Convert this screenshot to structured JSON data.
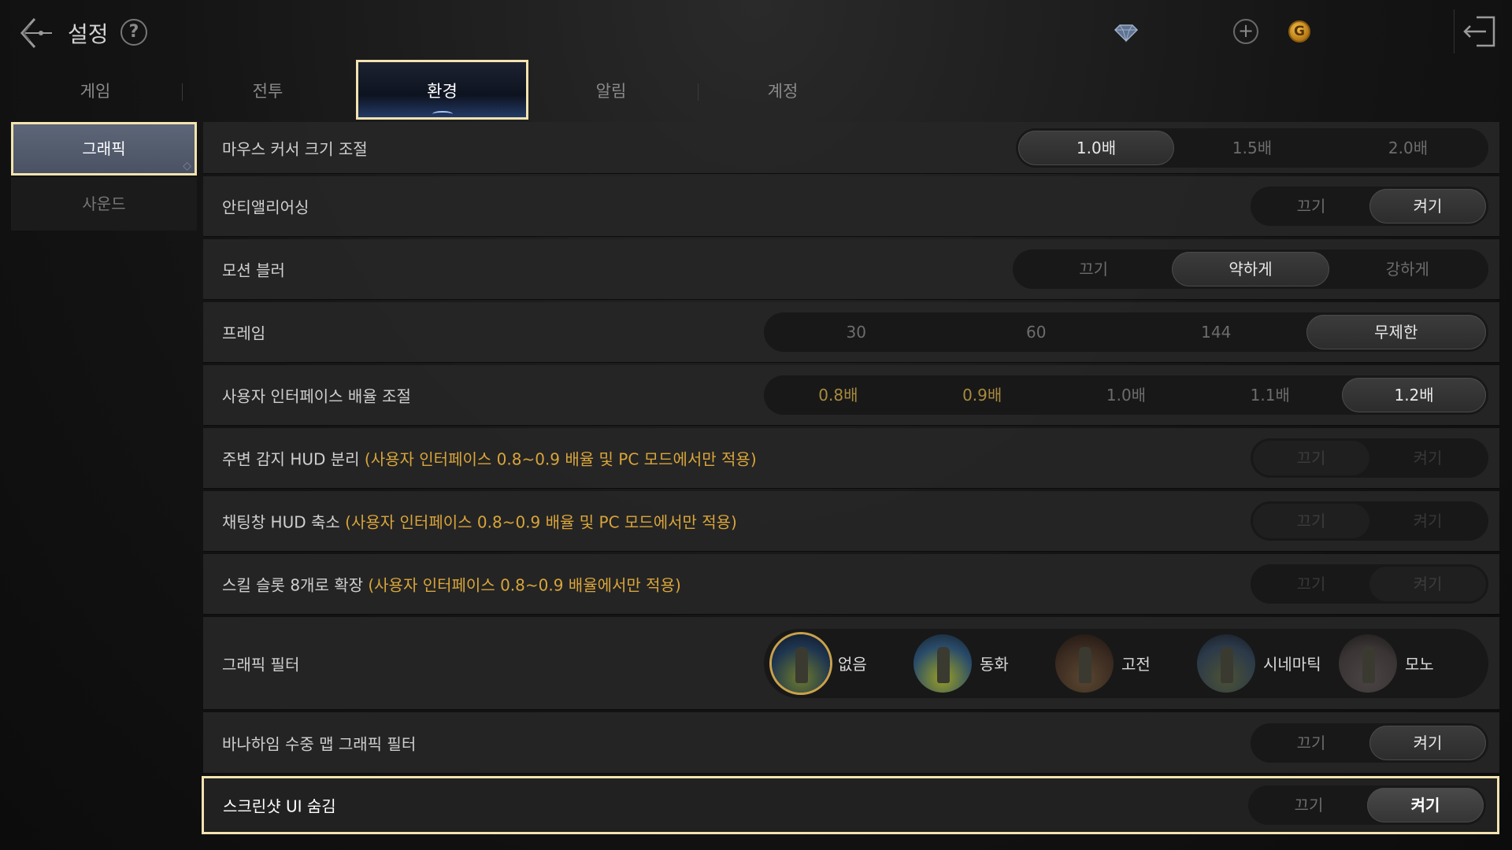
{
  "header": {
    "title": "설정",
    "help_label": "?",
    "plus_label": "+",
    "coin_label": "G",
    "icons": [
      "back-icon",
      "help-icon",
      "diamond-icon",
      "plus-icon",
      "gold-coin-icon",
      "exit-icon"
    ]
  },
  "tabs": [
    {
      "label": "게임",
      "active": false
    },
    {
      "label": "전투",
      "active": false
    },
    {
      "label": "환경",
      "active": true
    },
    {
      "label": "알림",
      "active": false
    },
    {
      "label": "계정",
      "active": false
    }
  ],
  "sidebar": {
    "items": [
      {
        "label": "그래픽",
        "active": true
      },
      {
        "label": "사운드",
        "active": false
      }
    ]
  },
  "settings": {
    "cursor_size": {
      "label": "마우스 커서 크기 조절",
      "options": [
        "1.0배",
        "1.5배",
        "2.0배"
      ],
      "selected": "1.0배"
    },
    "antialiasing": {
      "label": "안티앨리어싱",
      "options": [
        "끄기",
        "켜기"
      ],
      "selected": "켜기"
    },
    "motion_blur": {
      "label": "모션 블러",
      "options": [
        "끄기",
        "약하게",
        "강하게"
      ],
      "selected": "약하게"
    },
    "frame": {
      "label": "프레임",
      "options": [
        "30",
        "60",
        "144",
        "무제한"
      ],
      "selected": "무제한"
    },
    "ui_scale": {
      "label": "사용자 인터페이스 배율 조절",
      "options": [
        "0.8배",
        "0.9배",
        "1.0배",
        "1.1배",
        "1.2배"
      ],
      "selected": "1.2배"
    },
    "hud_split": {
      "label": "주변 감지 HUD 분리",
      "note": "(사용자 인터페이스 0.8~0.9 배율 및 PC 모드에서만 적용)",
      "options": [
        "끄기",
        "켜기"
      ],
      "selected": "끄기",
      "disabled": true
    },
    "chat_hud": {
      "label": "채팅창 HUD 축소",
      "note": "(사용자 인터페이스 0.8~0.9 배율 및 PC 모드에서만 적용)",
      "options": [
        "끄기",
        "켜기"
      ],
      "selected": "끄기",
      "disabled": true
    },
    "skill_slots": {
      "label": "스킬 슬롯 8개로 확장",
      "note": "(사용자 인터페이스 0.8~0.9 배율에서만 적용)",
      "options": [
        "끄기",
        "켜기"
      ],
      "selected": "켜기",
      "disabled": true
    },
    "graphic_filter": {
      "label": "그래픽 필터",
      "options": [
        "없음",
        "동화",
        "고전",
        "시네마틱",
        "모노"
      ],
      "selected": "없음"
    },
    "underwater_filter": {
      "label": "바나하임 수중 맵 그래픽 필터",
      "options": [
        "끄기",
        "켜기"
      ],
      "selected": "켜기"
    },
    "screenshot_ui": {
      "label": "스크린샷 UI 숨김",
      "options": [
        "끄기",
        "켜기"
      ],
      "selected": "켜기"
    }
  },
  "colors": {
    "accent_border": "#f3e3b0",
    "note_text": "#d9a53a",
    "gold_option": "#a88a3e"
  }
}
